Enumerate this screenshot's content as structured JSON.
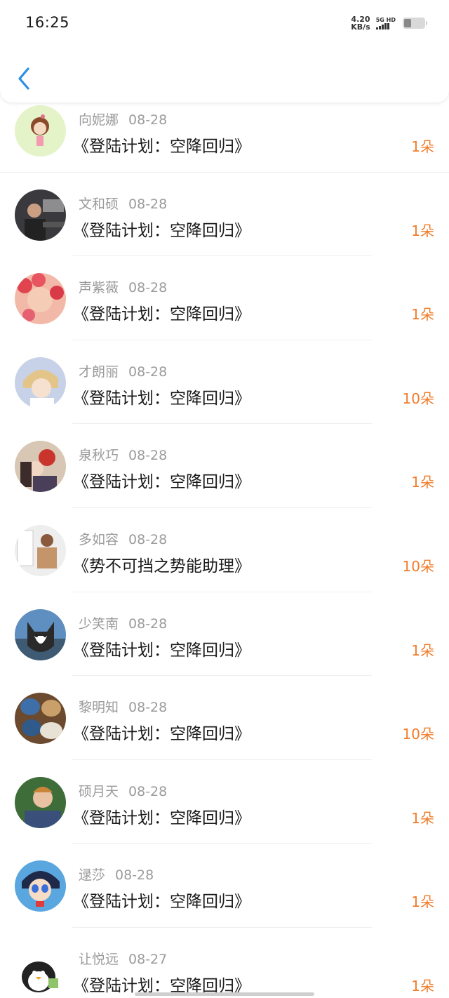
{
  "status_bar": {
    "time": "16:25",
    "net_speed_value": "4.20",
    "net_speed_unit": "KB/s",
    "network": "5G HD"
  },
  "nav": {
    "back_icon": "chevron-left-icon"
  },
  "colors": {
    "accent": "#f07c2a",
    "back": "#2b8fe6",
    "muted": "#9b9b9b"
  },
  "items": [
    {
      "name": "向妮娜",
      "date": "08-28",
      "title": "《登陆计划：空降回归》",
      "gift": "1朵"
    },
    {
      "name": "文和硕",
      "date": "08-28",
      "title": "《登陆计划：空降回归》",
      "gift": "1朵"
    },
    {
      "name": "声紫薇",
      "date": "08-28",
      "title": "《登陆计划：空降回归》",
      "gift": "1朵"
    },
    {
      "name": "才朗丽",
      "date": "08-28",
      "title": "《登陆计划：空降回归》",
      "gift": "10朵"
    },
    {
      "name": "泉秋巧",
      "date": "08-28",
      "title": "《登陆计划：空降回归》",
      "gift": "1朵"
    },
    {
      "name": "多如容",
      "date": "08-28",
      "title": "《势不可挡之势能助理》",
      "gift": "10朵"
    },
    {
      "name": "少笑南",
      "date": "08-28",
      "title": "《登陆计划：空降回归》",
      "gift": "1朵"
    },
    {
      "name": "黎明知",
      "date": "08-28",
      "title": "《登陆计划：空降回归》",
      "gift": "10朵"
    },
    {
      "name": "硕月天",
      "date": "08-28",
      "title": "《登陆计划：空降回归》",
      "gift": "1朵"
    },
    {
      "name": "逯莎",
      "date": "08-28",
      "title": "《登陆计划：空降回归》",
      "gift": "1朵"
    },
    {
      "name": "让悦远",
      "date": "08-27",
      "title": "《登陆计划：空降回归》",
      "gift": "1朵"
    }
  ]
}
